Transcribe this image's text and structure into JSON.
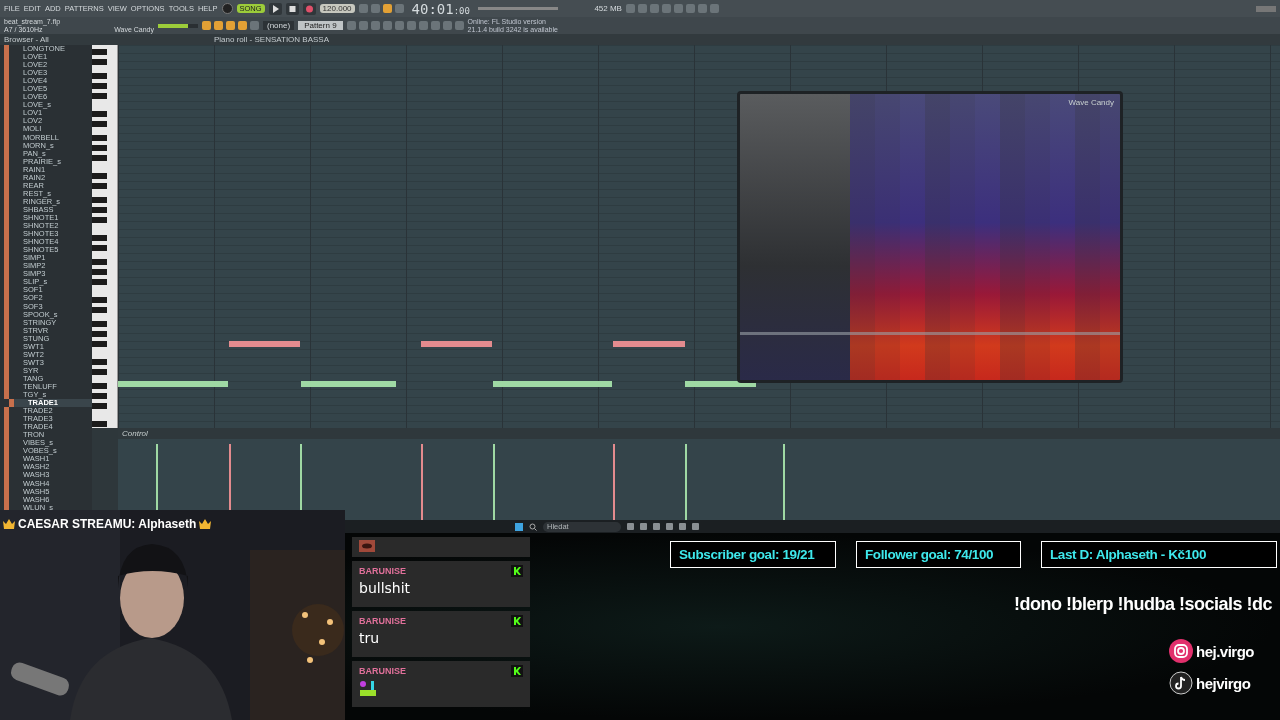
{
  "menu": [
    "FILE",
    "EDIT",
    "ADD",
    "PATTERNS",
    "VIEW",
    "OPTIONS",
    "TOOLS",
    "HELP"
  ],
  "transport": {
    "mode": "SONG",
    "tempo": "120.000",
    "time": "40:01",
    "time_small": ":00",
    "volume": {
      "level": 0.75
    },
    "memory": "452 MB"
  },
  "project": {
    "file": "beat_stream_7.flp",
    "info": "A7 / 3610Hz",
    "hint": "Wave Candy"
  },
  "pattern": {
    "mode": "(none)",
    "name": "Pattern 9"
  },
  "news": {
    "title": "Online: FL Studio version",
    "body": "21.1.4 build 3242 is available"
  },
  "browser": {
    "title": "Browser - All",
    "items": [
      {
        "name": "LONGTONE",
        "selected": false
      },
      {
        "name": "LOVE1",
        "selected": false
      },
      {
        "name": "LOVE2",
        "selected": false
      },
      {
        "name": "LOVE3",
        "selected": false
      },
      {
        "name": "LOVE4",
        "selected": false
      },
      {
        "name": "LOVE5",
        "selected": false
      },
      {
        "name": "LOVE6",
        "selected": false
      },
      {
        "name": "LOVE_s",
        "selected": false
      },
      {
        "name": "LOV1",
        "selected": false
      },
      {
        "name": "LOV2",
        "selected": false
      },
      {
        "name": "MOLI",
        "selected": false
      },
      {
        "name": "MORBELL",
        "selected": false
      },
      {
        "name": "MORN_s",
        "selected": false
      },
      {
        "name": "PAN_s",
        "selected": false
      },
      {
        "name": "PRAIRIE_s",
        "selected": false
      },
      {
        "name": "RAIN1",
        "selected": false
      },
      {
        "name": "RAIN2",
        "selected": false
      },
      {
        "name": "REAR",
        "selected": false
      },
      {
        "name": "REST_s",
        "selected": false
      },
      {
        "name": "RINGER_s",
        "selected": false
      },
      {
        "name": "SHBASS",
        "selected": false
      },
      {
        "name": "SHNOTE1",
        "selected": false
      },
      {
        "name": "SHNOTE2",
        "selected": false
      },
      {
        "name": "SHNOTE3",
        "selected": false
      },
      {
        "name": "SHNOTE4",
        "selected": false
      },
      {
        "name": "SHNOTE5",
        "selected": false
      },
      {
        "name": "SIMP1",
        "selected": false
      },
      {
        "name": "SIMP2",
        "selected": false
      },
      {
        "name": "SIMP3",
        "selected": false
      },
      {
        "name": "SLIP_s",
        "selected": false
      },
      {
        "name": "SOF1",
        "selected": false
      },
      {
        "name": "SOF2",
        "selected": false
      },
      {
        "name": "SOF3",
        "selected": false
      },
      {
        "name": "SPOOK_s",
        "selected": false
      },
      {
        "name": "STRINGY",
        "selected": false
      },
      {
        "name": "STRVR",
        "selected": false
      },
      {
        "name": "STUNG",
        "selected": false
      },
      {
        "name": "SWT1",
        "selected": false
      },
      {
        "name": "SWT2",
        "selected": false
      },
      {
        "name": "SWT3",
        "selected": false
      },
      {
        "name": "SYR",
        "selected": false
      },
      {
        "name": "TANG",
        "selected": false
      },
      {
        "name": "TENLUFF",
        "selected": false
      },
      {
        "name": "TGY_s",
        "selected": false,
        "children": [
          {
            "name": "TRADE1",
            "selected": true
          }
        ]
      },
      {
        "name": "TRADE2",
        "selected": false
      },
      {
        "name": "TRADE3",
        "selected": false
      },
      {
        "name": "TRADE4",
        "selected": false
      },
      {
        "name": "TRON",
        "selected": false
      },
      {
        "name": "VIBES_s",
        "selected": false
      },
      {
        "name": "VOBES_s",
        "selected": false
      },
      {
        "name": "WASH1",
        "selected": false
      },
      {
        "name": "WASH2",
        "selected": false
      },
      {
        "name": "WASH3",
        "selected": false
      },
      {
        "name": "WASH4",
        "selected": false
      },
      {
        "name": "WASH5",
        "selected": false
      },
      {
        "name": "WASH6",
        "selected": false
      },
      {
        "name": "WLUN_s",
        "selected": false
      }
    ]
  },
  "piano_roll": {
    "title": "Piano roll - SENSATION BASSA",
    "lane": "Control"
  },
  "wave_candy": {
    "title": "Wave Candy"
  },
  "taskbar": {
    "search_placeholder": "Hledat"
  },
  "stream": {
    "banner": "CAESAR STREAMU: Alphaseth",
    "chat": [
      {
        "kind": "emote"
      },
      {
        "kind": "text",
        "user": "BARUNISE",
        "text": "bullshit"
      },
      {
        "kind": "text",
        "user": "BARUNISE",
        "text": "tru"
      },
      {
        "kind": "emote",
        "user": "BARUNISE"
      }
    ],
    "goals": [
      "Subscriber goal: 19/21",
      "Follower goal: 74/100",
      "Last D: Alphaseth - Kč100"
    ],
    "commands": "!dono !blerp !hudba !socials !dc",
    "socials": [
      {
        "kind": "instagram",
        "handle": "hej.virgo"
      },
      {
        "kind": "tiktok",
        "handle": "hejvirgo"
      }
    ]
  }
}
